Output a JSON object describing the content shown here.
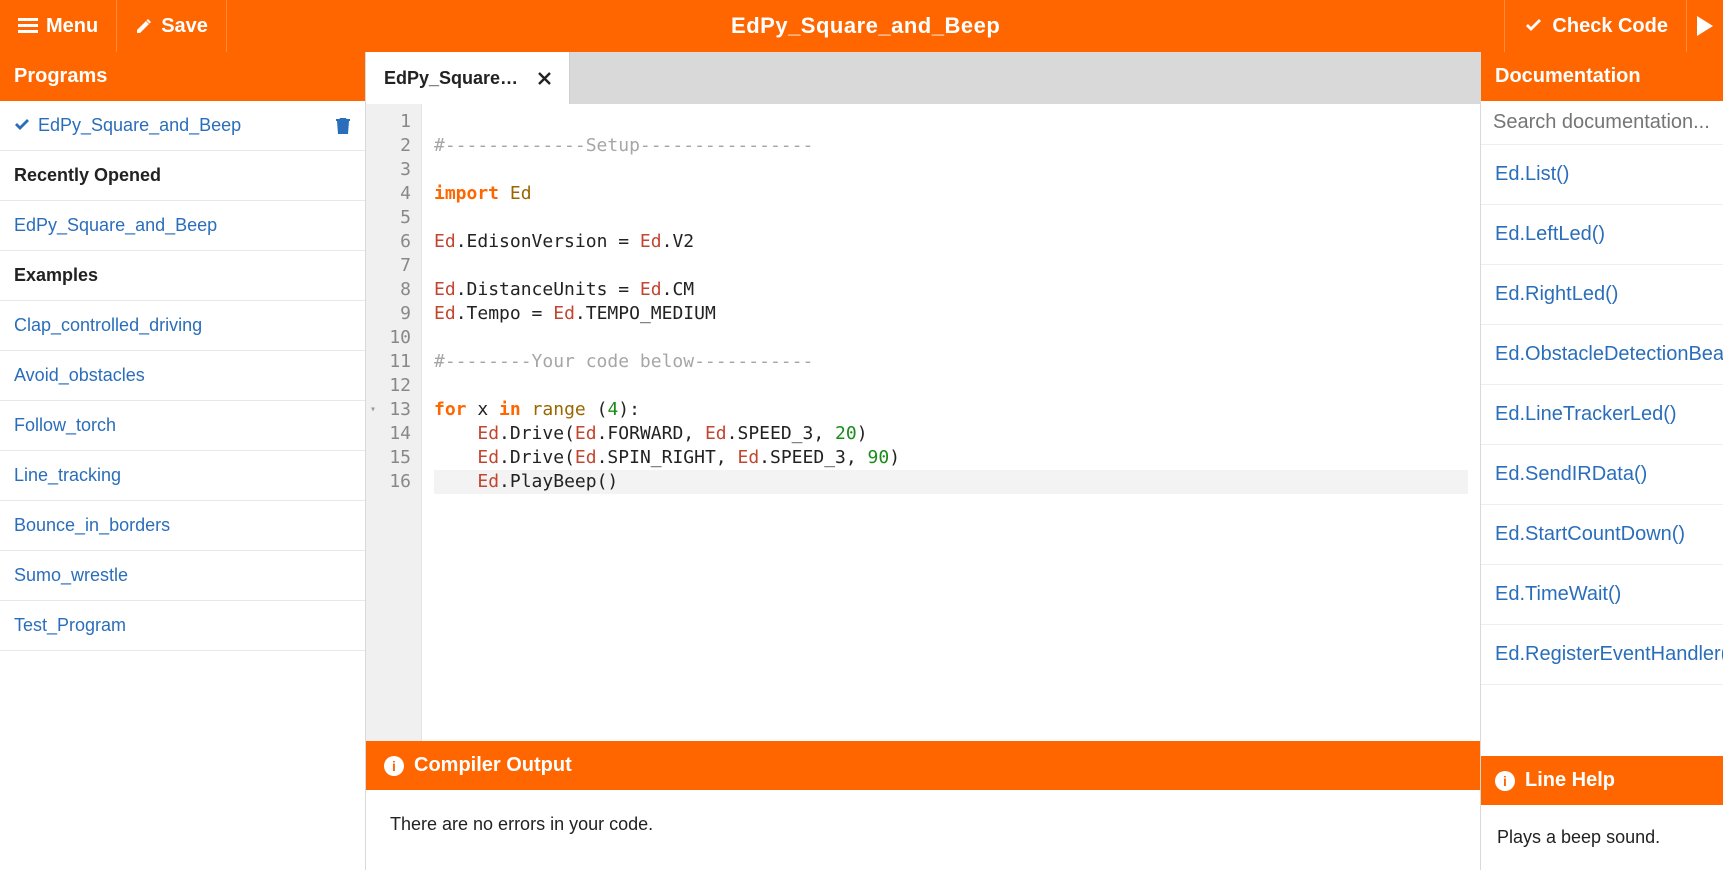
{
  "topbar": {
    "menu_label": "Menu",
    "save_label": "Save",
    "title": "EdPy_Square_and_Beep",
    "check_label": "Check Code"
  },
  "sidebar": {
    "programs_header": "Programs",
    "active_program": "EdPy_Square_and_Beep",
    "recent_header": "Recently Opened",
    "recent": [
      "EdPy_Square_and_Beep"
    ],
    "examples_header": "Examples",
    "examples": [
      "Clap_controlled_driving",
      "Avoid_obstacles",
      "Follow_torch",
      "Line_tracking",
      "Bounce_in_borders",
      "Sumo_wrestle",
      "Test_Program"
    ]
  },
  "tabs": [
    {
      "label": "EdPy_Square…"
    }
  ],
  "editor": {
    "line_count": 16,
    "fold_lines": [
      13
    ],
    "highlighted_line": 16,
    "lines": [
      {
        "n": 1,
        "tokens": [
          {
            "t": "",
            "c": ""
          }
        ]
      },
      {
        "n": 2,
        "tokens": [
          {
            "t": "#-------------Setup----------------",
            "c": "t-comment"
          }
        ]
      },
      {
        "n": 3,
        "tokens": [
          {
            "t": "",
            "c": ""
          }
        ]
      },
      {
        "n": 4,
        "tokens": [
          {
            "t": "import ",
            "c": "t-kw"
          },
          {
            "t": "Ed",
            "c": "t-name"
          }
        ]
      },
      {
        "n": 5,
        "tokens": [
          {
            "t": "",
            "c": ""
          }
        ]
      },
      {
        "n": 6,
        "tokens": [
          {
            "t": "Ed",
            "c": "t-cls"
          },
          {
            "t": ".EdisonVersion = ",
            "c": "t-id"
          },
          {
            "t": "Ed",
            "c": "t-cls"
          },
          {
            "t": ".V2",
            "c": "t-id"
          }
        ]
      },
      {
        "n": 7,
        "tokens": [
          {
            "t": "",
            "c": ""
          }
        ]
      },
      {
        "n": 8,
        "tokens": [
          {
            "t": "Ed",
            "c": "t-cls"
          },
          {
            "t": ".DistanceUnits = ",
            "c": "t-id"
          },
          {
            "t": "Ed",
            "c": "t-cls"
          },
          {
            "t": ".CM",
            "c": "t-id"
          }
        ]
      },
      {
        "n": 9,
        "tokens": [
          {
            "t": "Ed",
            "c": "t-cls"
          },
          {
            "t": ".Tempo = ",
            "c": "t-id"
          },
          {
            "t": "Ed",
            "c": "t-cls"
          },
          {
            "t": ".TEMPO_MEDIUM",
            "c": "t-id"
          }
        ]
      },
      {
        "n": 10,
        "tokens": [
          {
            "t": "",
            "c": ""
          }
        ]
      },
      {
        "n": 11,
        "tokens": [
          {
            "t": "#--------Your code below-----------",
            "c": "t-comment"
          }
        ]
      },
      {
        "n": 12,
        "tokens": [
          {
            "t": "",
            "c": ""
          }
        ]
      },
      {
        "n": 13,
        "tokens": [
          {
            "t": "for ",
            "c": "t-kw"
          },
          {
            "t": "x ",
            "c": "t-id"
          },
          {
            "t": "in ",
            "c": "t-kw"
          },
          {
            "t": "range ",
            "c": "t-name"
          },
          {
            "t": "(",
            "c": "t-id"
          },
          {
            "t": "4",
            "c": "t-num"
          },
          {
            "t": "):",
            "c": "t-id"
          }
        ]
      },
      {
        "n": 14,
        "tokens": [
          {
            "t": "    ",
            "c": ""
          },
          {
            "t": "Ed",
            "c": "t-cls"
          },
          {
            "t": ".Drive(",
            "c": "t-id"
          },
          {
            "t": "Ed",
            "c": "t-cls"
          },
          {
            "t": ".FORWARD, ",
            "c": "t-id"
          },
          {
            "t": "Ed",
            "c": "t-cls"
          },
          {
            "t": ".SPEED_3, ",
            "c": "t-id"
          },
          {
            "t": "20",
            "c": "t-num"
          },
          {
            "t": ")",
            "c": "t-id"
          }
        ]
      },
      {
        "n": 15,
        "tokens": [
          {
            "t": "    ",
            "c": ""
          },
          {
            "t": "Ed",
            "c": "t-cls"
          },
          {
            "t": ".Drive(",
            "c": "t-id"
          },
          {
            "t": "Ed",
            "c": "t-cls"
          },
          {
            "t": ".SPIN_RIGHT, ",
            "c": "t-id"
          },
          {
            "t": "Ed",
            "c": "t-cls"
          },
          {
            "t": ".SPEED_3, ",
            "c": "t-id"
          },
          {
            "t": "90",
            "c": "t-num"
          },
          {
            "t": ")",
            "c": "t-id"
          }
        ]
      },
      {
        "n": 16,
        "tokens": [
          {
            "t": "    ",
            "c": ""
          },
          {
            "t": "Ed",
            "c": "t-cls"
          },
          {
            "t": ".PlayBeep()",
            "c": "t-id"
          }
        ]
      }
    ]
  },
  "compiler": {
    "header": "Compiler Output",
    "body": "There are no errors in your code."
  },
  "docs": {
    "header": "Documentation",
    "search_placeholder": "Search documentation...",
    "items": [
      "Ed.List()",
      "Ed.LeftLed()",
      "Ed.RightLed()",
      "Ed.ObstacleDetectionBeam()",
      "Ed.LineTrackerLed()",
      "Ed.SendIRData()",
      "Ed.StartCountDown()",
      "Ed.TimeWait()",
      "Ed.RegisterEventHandler()"
    ],
    "linehelp_header": "Line Help",
    "linehelp_body": "Plays a beep sound."
  }
}
